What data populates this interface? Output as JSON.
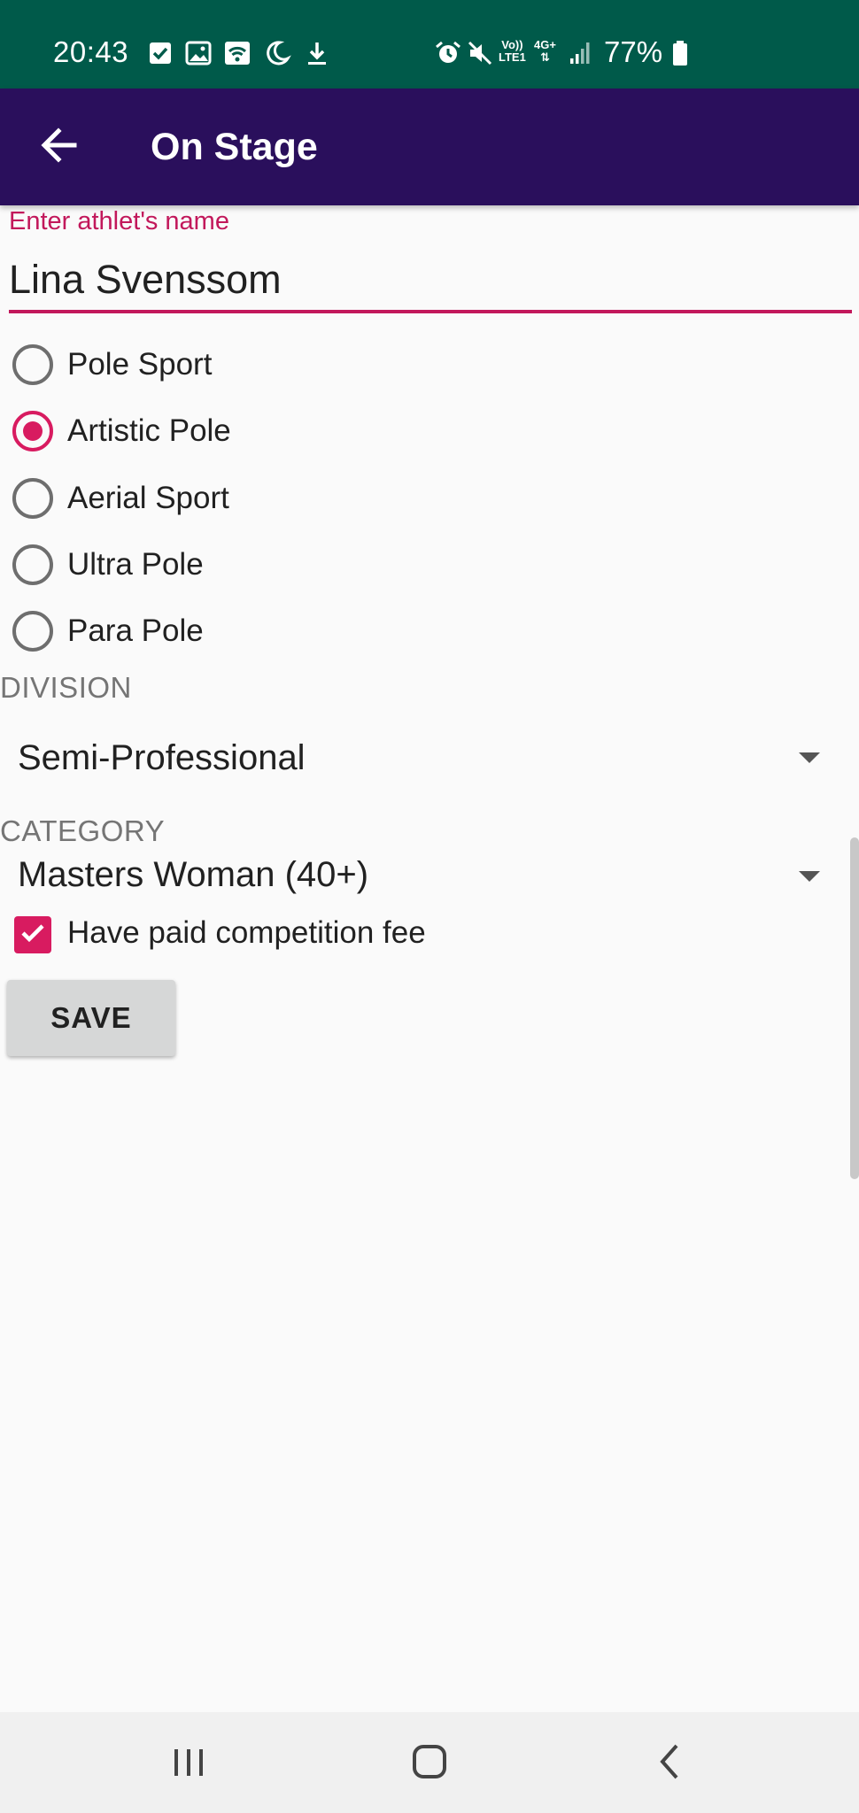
{
  "status_bar": {
    "time": "20:43",
    "lte_line1": "Vo))",
    "lte_line2": "LTE1",
    "network": "4G+",
    "battery": "77%",
    "icons": [
      "checkbox-notification-icon",
      "gallery-icon",
      "wifi-icon",
      "moon-icon",
      "download-icon",
      "alarm-icon",
      "mute-icon",
      "signal-icon",
      "battery-icon"
    ]
  },
  "app_bar": {
    "title": "On Stage",
    "back_icon": "arrow-back-icon"
  },
  "form": {
    "name_label": "Enter athlet's name",
    "name_value": "Lina Svenssom",
    "sports": [
      {
        "label": "Pole Sport",
        "checked": false
      },
      {
        "label": "Artistic Pole",
        "checked": true
      },
      {
        "label": "Aerial Sport",
        "checked": false
      },
      {
        "label": "Ultra Pole",
        "checked": false
      },
      {
        "label": "Para Pole",
        "checked": false
      }
    ],
    "division_label": "DIVISION",
    "division_value": "Semi-Professional",
    "category_label": "CATEGORY",
    "category_value": "Masters Woman (40+)",
    "fee_label": "Have paid competition fee",
    "fee_checked": true,
    "save_label": "SAVE"
  },
  "colors": {
    "status_bar": "#005a4a",
    "app_bar": "#2a0f5c",
    "accent": "#d81b60",
    "background": "#fafafa"
  },
  "nav_bar": {
    "icons": [
      "recent-apps-icon",
      "home-icon",
      "back-icon"
    ]
  }
}
